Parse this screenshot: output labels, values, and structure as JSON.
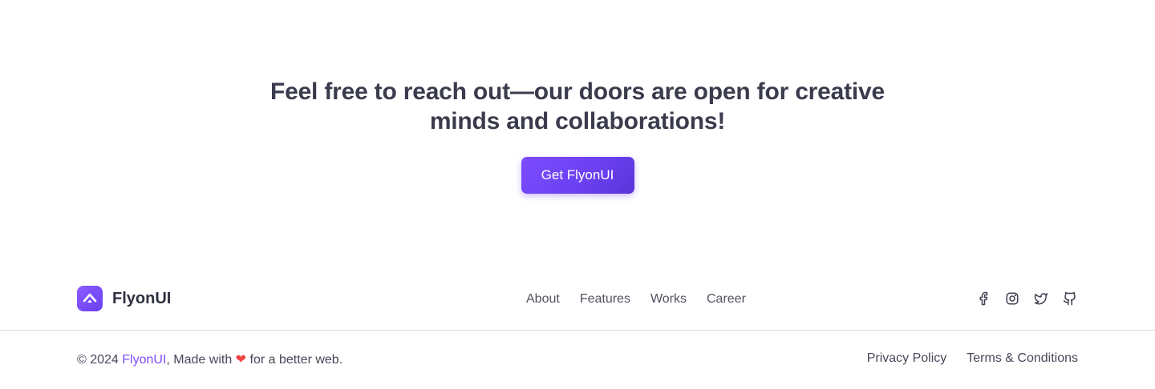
{
  "cta": {
    "heading": "Feel free to reach out—our doors are open for creative minds and collaborations!",
    "button_label": "Get FlyonUI"
  },
  "footer": {
    "brand": "FlyonUI",
    "nav": [
      "About",
      "Features",
      "Works",
      "Career"
    ],
    "socials": [
      "facebook-icon",
      "instagram-icon",
      "twitter-icon",
      "github-icon"
    ],
    "copyright_prefix": "© 2024 ",
    "copyright_brand": "FlyonUI",
    "copyright_middle": ", Made with ",
    "copyright_heart": "❤",
    "copyright_suffix": " for a better web.",
    "legal": [
      "Privacy Policy",
      "Terms & Conditions"
    ]
  },
  "colors": {
    "accent": "#7c4dff",
    "heart": "#ef4444",
    "text": "#3a3b4c"
  }
}
